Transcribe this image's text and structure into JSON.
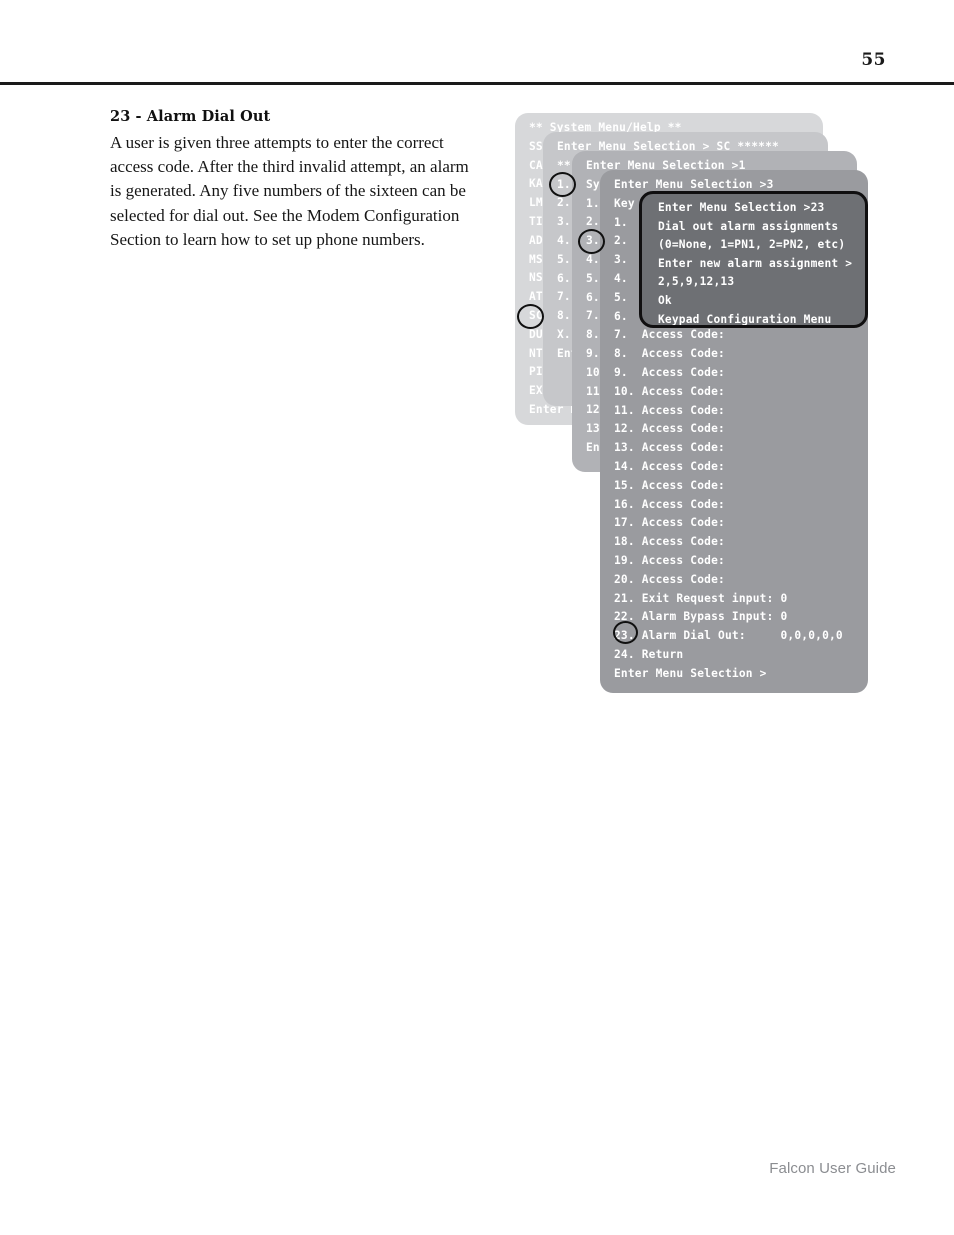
{
  "page": {
    "number": "55",
    "footer": "Falcon User Guide"
  },
  "article": {
    "title": "23 - Alarm Dial Out",
    "body": "A user is given three attempts to enter the correct access code.  After the third invalid attempt, an alarm is generated.  Any five numbers of the sixteen can be selected for dial out.  See the Modem Configuration Section to learn how to set up phone numbers."
  },
  "terminal": {
    "window1": {
      "name": "system-menu-help",
      "lines": [
        "** System Menu/Help **",
        "SS - ",
        "CA - ",
        "KA - ",
        "LM - ",
        "TI - ",
        "AD - ",
        "MS - ",
        "NS - ",
        "AT - ",
        "SC - ",
        "DU - ",
        "NT - ",
        "PIN",
        "EX -",
        "Enter Me"
      ]
    },
    "window2": {
      "name": "menu-selection-sc",
      "lines": [
        "Enter Menu Selection > SC ******",
        "** ",
        "1. ",
        "2. ",
        "3. ",
        "4. ",
        "5. ",
        "6. ",
        "7. ",
        "8. ",
        "X. ",
        "Ent"
      ]
    },
    "window3": {
      "name": "menu-selection-1",
      "lines": [
        "Enter Menu Selection >1",
        "Sys",
        "1. ",
        "2. ",
        "3. ",
        "4. ",
        "5. ",
        "6. ",
        "7. ",
        "8. ",
        "9. ",
        "10. ",
        "11. ",
        "12. ",
        "13. ",
        "Ent"
      ]
    },
    "window4": {
      "name": "keypad-configuration-menu",
      "lines": [
        "Enter Menu Selection >3",
        "Key",
        "1. ",
        "2. ",
        "3. ",
        "4. ",
        "5. ",
        "6. ",
        "7.  Access Code:",
        "8.  Access Code:",
        "9.  Access Code:",
        "10. Access Code:",
        "11. Access Code:",
        "12. Access Code:",
        "13. Access Code:",
        "14. Access Code:",
        "15. Access Code:",
        "16. Access Code:",
        "17. Access Code:",
        "18. Access Code:",
        "19. Access Code:",
        "20. Access Code:",
        "21. Exit Request input: 0",
        "22. Alarm Bypass Input: 0",
        "23. Alarm Dial Out:     0,0,0,0,0",
        "24. Return",
        "Enter Menu Selection >"
      ]
    },
    "window5": {
      "name": "alarm-dial-out-callout",
      "lines": [
        "Enter Menu Selection >23",
        "Dial out alarm assignments",
        "(0=None, 1=PN1, 2=PN2, etc)",
        "Enter new alarm assignment >",
        "2,5,9,12,13",
        "Ok",
        "Keypad Configuration Menu"
      ]
    }
  },
  "annotations": [
    {
      "name": "annotation-circle-menu-1",
      "label": "1."
    },
    {
      "name": "annotation-circle-menu-3",
      "label": "3."
    },
    {
      "name": "annotation-circle-menu-sc",
      "label": "SC"
    },
    {
      "name": "annotation-circle-menu-23",
      "label": "23"
    }
  ]
}
